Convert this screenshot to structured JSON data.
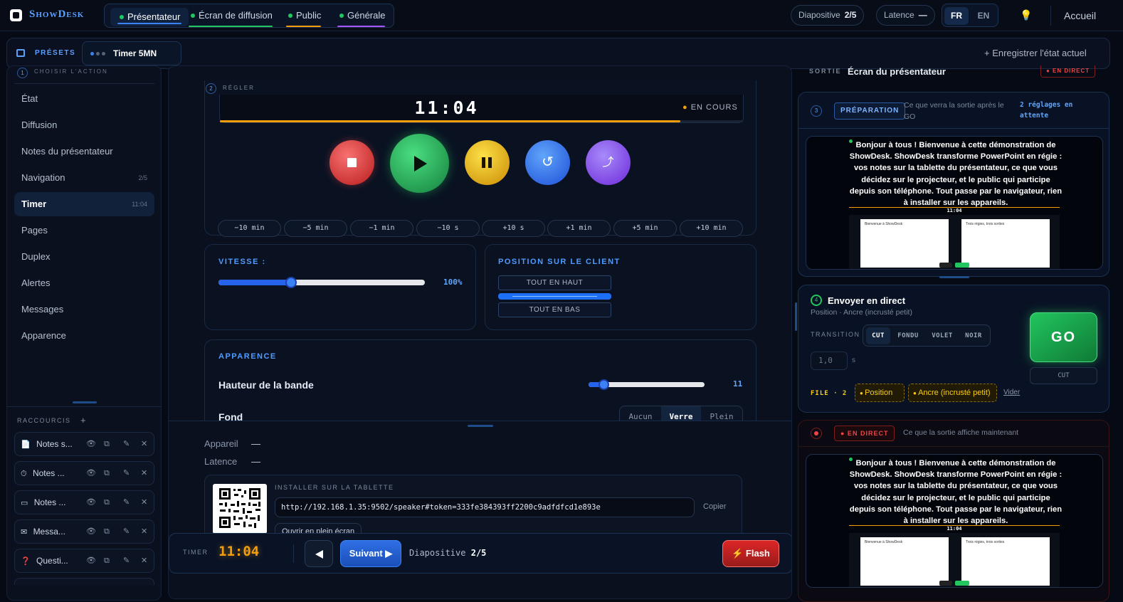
{
  "app": {
    "name": "ShowDesk"
  },
  "tabs": [
    {
      "label": "Présentateur",
      "color": "#3b82f6"
    },
    {
      "label": "Écran de diffusion",
      "color": "#22c55e"
    },
    {
      "label": "Public",
      "color": "#f59e0b"
    },
    {
      "label": "Générale",
      "color": "#a855f7"
    }
  ],
  "topbar": {
    "slide_label": "Diapositive",
    "slide_value": "2/5",
    "latency_label": "Latence",
    "latency_value": "—",
    "lang_fr": "FR",
    "lang_en": "EN",
    "home": "Accueil"
  },
  "presets": {
    "title": "PRÉSETS",
    "active_preset": "Timer 5MN",
    "save": "+ Enregistrer l'état actuel"
  },
  "sidebar": {
    "step_header": "CHOISIR L'ACTION",
    "step_num": "1",
    "items": [
      {
        "label": "État"
      },
      {
        "label": "Diffusion"
      },
      {
        "label": "Notes du présentateur"
      },
      {
        "label": "Navigation",
        "side": "2/5"
      },
      {
        "label": "Timer",
        "side": "11:04"
      },
      {
        "label": "Pages"
      },
      {
        "label": "Duplex"
      },
      {
        "label": "Alertes"
      },
      {
        "label": "Messages"
      },
      {
        "label": "Apparence"
      }
    ],
    "shortcuts_title": "RACCOURCIS",
    "shortcuts_add": "+",
    "shortcuts": [
      {
        "icon": "📄",
        "label": "Notes s..."
      },
      {
        "icon": "⏱",
        "label": "Notes ..."
      },
      {
        "icon": "▭",
        "label": "Notes ..."
      },
      {
        "icon": "✉",
        "label": "Messa..."
      },
      {
        "icon": "❓",
        "label": "Questi..."
      }
    ]
  },
  "timer": {
    "step_num": "2",
    "step_label": "RÉGLER",
    "display": "11:04",
    "status": "EN COURS",
    "progress": 0.88,
    "adjust": [
      "−10 min",
      "−5 min",
      "−1 min",
      "−10 s",
      "+10 s",
      "+1 min",
      "+5 min",
      "+10 min"
    ]
  },
  "speed": {
    "title": "VITESSE :",
    "value": "100%",
    "level": 0.35
  },
  "position": {
    "title": "POSITION SUR LE CLIENT",
    "top": "TOUT EN HAUT",
    "bottom": "TOUT EN BAS"
  },
  "appearance": {
    "title": "APPARENCE",
    "band_label": "Hauteur de la bande",
    "band_value": "11",
    "band_level": 0.13,
    "bg_label": "Fond",
    "bg_options": [
      "Aucun",
      "Verre",
      "Plein"
    ],
    "bg_selected": "Verre"
  },
  "device": {
    "appareil_label": "Appareil",
    "appareil_value": "—",
    "latence_label": "Latence",
    "latence_value": "—",
    "install_title": "INSTALLER SUR LA TABLETTE",
    "url": "http://192.168.1.35:9502/speaker#token=333fe384393ff2200c9adfdfcd1e893e",
    "copy": "Copier",
    "fullscreen": "Ouvrir en plein écran"
  },
  "bottombar": {
    "timer_label": "TIMER",
    "timer_value": "11:04",
    "next": "Suivant ▶",
    "slide_label": "Diapositive",
    "slide_value": "2/5",
    "flash": "⚡ Flash"
  },
  "output": {
    "sortie_label": "SORTIE",
    "sortie_title": "Écran du présentateur",
    "live_badge": "● EN DIRECT",
    "prep_num": "3",
    "prep_tag": "PRÉPARATION",
    "prep_desc": "Ce que verra la sortie après le GO",
    "prep_pending": "2 réglages en attente",
    "preview_text": "Bonjour à tous ! Bienvenue à cette démonstration de ShowDesk. ShowDesk transforme PowerPoint en régie : vos notes sur la tablette du présentateur, ce que vous décidez sur le projecteur, et le public qui participe depuis son téléphone. Tout passe par le navigateur, rien à installer sur les appareils.",
    "preview_timer": "11:04",
    "mini_slide1": "Bienvenue à ShowDesk",
    "mini_slide2": "Trois régies, trois sorties",
    "send_num": "4",
    "send_title": "Envoyer en direct",
    "send_sub": "Position · Ancre (incrusté petit)",
    "transition_label": "TRANSITION",
    "transitions": [
      "CUT",
      "FONDU",
      "VOLET",
      "NOIR"
    ],
    "transition_selected": "CUT",
    "duration": "1,0",
    "duration_unit": "s",
    "go": "GO",
    "cut": "CUT",
    "queue_label": "FILE · 2",
    "queue": [
      "Position",
      "Ancre (incrusté petit)"
    ],
    "clear": "Vider",
    "live_tag": "● EN DIRECT",
    "live_desc": "Ce que la sortie affiche maintenant"
  }
}
